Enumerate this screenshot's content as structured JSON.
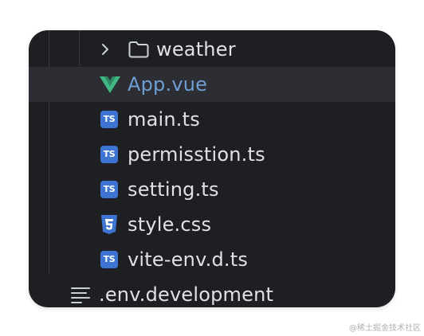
{
  "tree": {
    "folder": {
      "name": "weather",
      "icon": "folder-icon",
      "expander": "chevron-right-icon"
    },
    "files": [
      {
        "name": "App.vue",
        "icon": "vue-icon",
        "selected": true
      },
      {
        "name": "main.ts",
        "icon": "typescript-icon",
        "badge": "TS"
      },
      {
        "name": "permisstion.ts",
        "icon": "typescript-icon",
        "badge": "TS"
      },
      {
        "name": "setting.ts",
        "icon": "typescript-icon",
        "badge": "TS"
      },
      {
        "name": "style.css",
        "icon": "css-icon"
      },
      {
        "name": "vite-env.d.ts",
        "icon": "typescript-icon",
        "badge": "TS"
      }
    ],
    "bottom_item": {
      "name": ".env.development",
      "icon": "text-file-icon"
    }
  },
  "watermark": "@稀土掘金技术社区",
  "colors": {
    "panel_bg": "#1e1f22",
    "selected_bg": "#2c2e33",
    "text": "#dfe1e5",
    "vue_text": "#6e9ed3",
    "ts_badge": "#3d74d1",
    "vue_green": "#41b883",
    "css_blue": "#3d74d1"
  }
}
